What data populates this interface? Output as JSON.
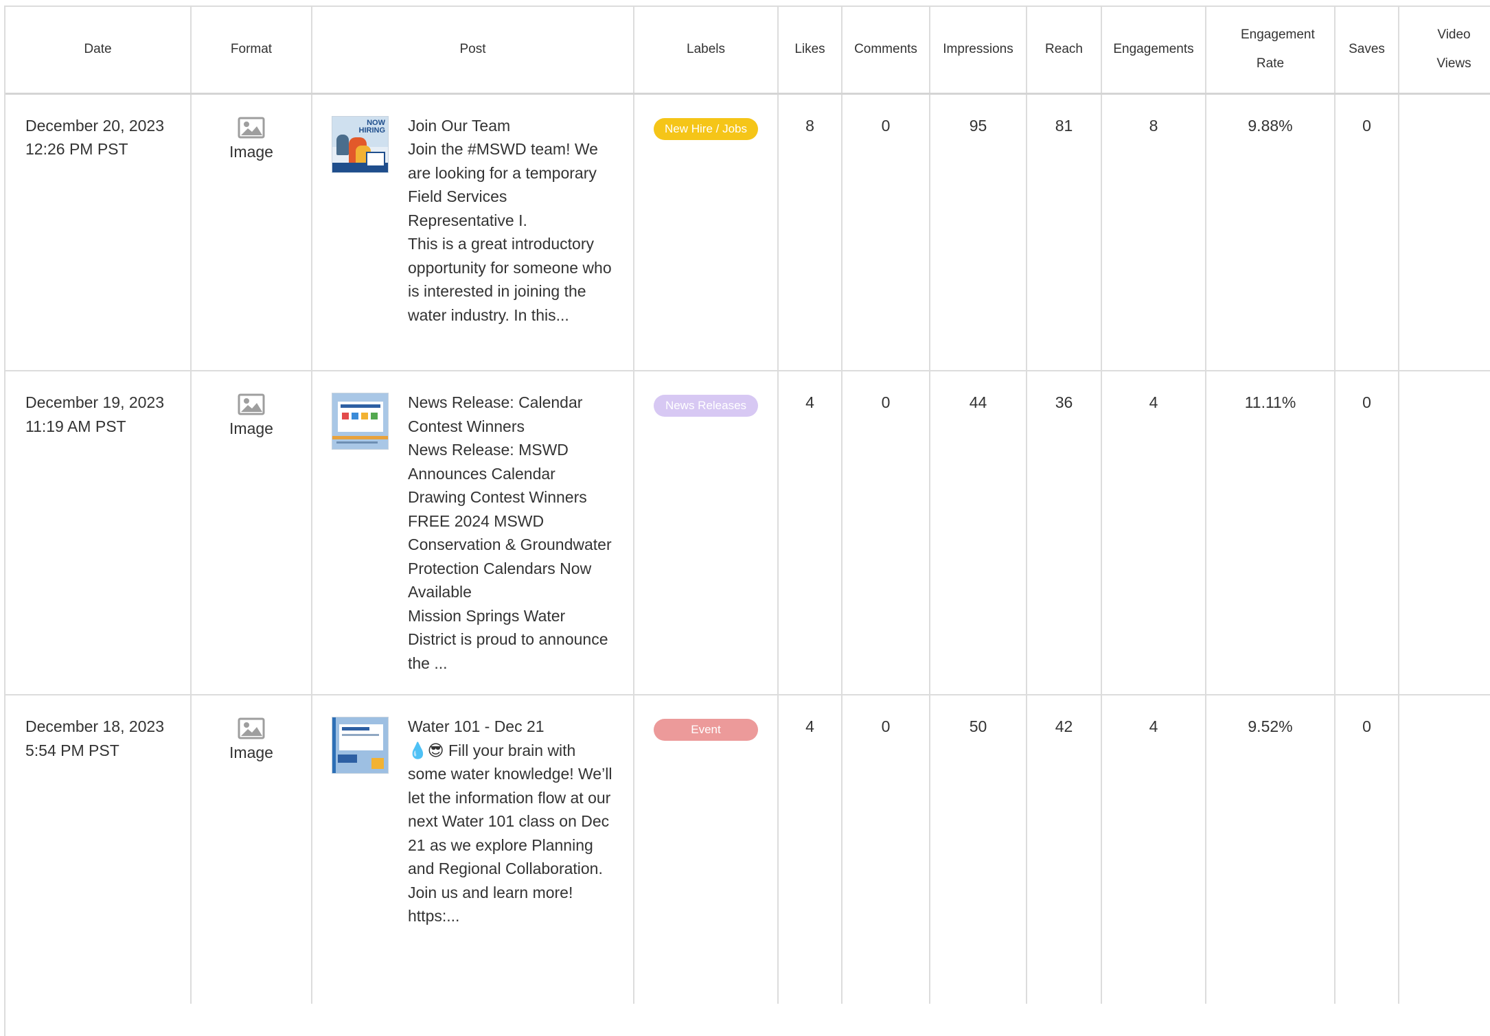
{
  "table": {
    "headers": {
      "date": "Date",
      "format": "Format",
      "post": "Post",
      "labels": "Labels",
      "likes": "Likes",
      "comments": "Comments",
      "impressions": "Impressions",
      "reach": "Reach",
      "engagements": "Engagements",
      "engagement_rate": "Engagement Rate",
      "saves": "Saves",
      "video_views": "Video Views"
    },
    "rows": [
      {
        "date": "December 20, 2023\n12:26 PM PST",
        "format_icon": "image-icon",
        "format": "Image",
        "thumbnail": "now-hiring-thumbnail",
        "post": "Join Our Team\nJoin the #MSWD team! We are looking for a temporary Field Services Representative I.\nThis is a great introductory opportunity for someone who is interested in joining the water industry. In this...",
        "label": "New Hire / Jobs",
        "label_color": "#f5c518",
        "likes": "8",
        "comments": "0",
        "impressions": "95",
        "reach": "81",
        "engagements": "8",
        "engagement_rate": "9.88%",
        "saves": "0",
        "video_views": ""
      },
      {
        "date": "December 19, 2023\n11:19 AM PST",
        "format_icon": "image-icon",
        "format": "Image",
        "thumbnail": "calendar-contest-thumbnail",
        "post": "News Release: Calendar Contest Winners\nNews Release: MSWD Announces Calendar Drawing Contest Winners\nFREE 2024 MSWD Conservation & Groundwater Protection Calendars Now Available\nMission Springs Water District is proud to announce the ...",
        "label": "News Releases",
        "label_color": "#d7c8f3",
        "likes": "4",
        "comments": "0",
        "impressions": "44",
        "reach": "36",
        "engagements": "4",
        "engagement_rate": "11.11%",
        "saves": "0",
        "video_views": ""
      },
      {
        "date": "December 18, 2023\n5:54 PM PST",
        "format_icon": "image-icon",
        "format": "Image",
        "thumbnail": "water-101-thumbnail",
        "post": "Water 101 - Dec 21\n💧😎 Fill your brain with some water knowledge! We’ll let the information flow at our next Water 101 class on Dec 21 as we explore Planning and Regional Collaboration. Join us and learn more!\nhttps:...",
        "label": "Event",
        "label_color": "#ec9a9a",
        "likes": "4",
        "comments": "0",
        "impressions": "50",
        "reach": "42",
        "engagements": "4",
        "engagement_rate": "9.52%",
        "saves": "0",
        "video_views": ""
      }
    ]
  }
}
